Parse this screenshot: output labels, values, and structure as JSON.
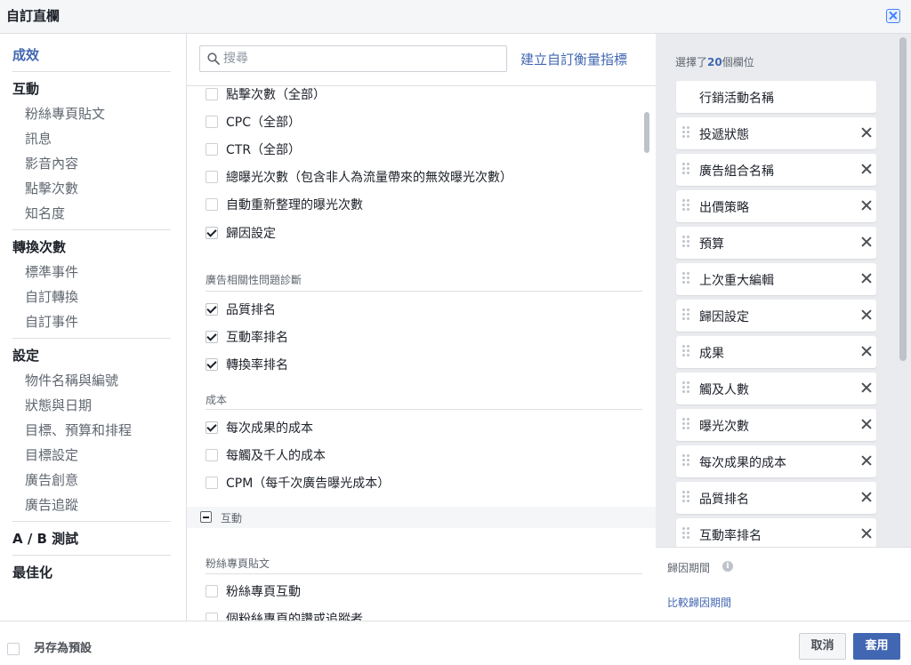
{
  "dialog": {
    "title": "自訂直欄"
  },
  "nav": {
    "items": [
      {
        "label": "成效",
        "type": "category",
        "active": true
      },
      {
        "label": "互動",
        "type": "category"
      },
      {
        "label": "粉絲專頁貼文",
        "type": "sub"
      },
      {
        "label": "訊息",
        "type": "sub"
      },
      {
        "label": "影音內容",
        "type": "sub"
      },
      {
        "label": "點擊次數",
        "type": "sub"
      },
      {
        "label": "知名度",
        "type": "sub"
      },
      {
        "label": "轉換次數",
        "type": "category"
      },
      {
        "label": "標準事件",
        "type": "sub"
      },
      {
        "label": "自訂轉換",
        "type": "sub"
      },
      {
        "label": "自訂事件",
        "type": "sub"
      },
      {
        "label": "設定",
        "type": "category"
      },
      {
        "label": "物件名稱與編號",
        "type": "sub"
      },
      {
        "label": "狀態與日期",
        "type": "sub"
      },
      {
        "label": "目標、預算和排程",
        "type": "sub"
      },
      {
        "label": "目標設定",
        "type": "sub"
      },
      {
        "label": "廣告創意",
        "type": "sub"
      },
      {
        "label": "廣告追蹤",
        "type": "sub"
      },
      {
        "label": "A / B 測試",
        "type": "category"
      },
      {
        "label": "最佳化",
        "type": "category"
      }
    ]
  },
  "search": {
    "placeholder": "搜尋",
    "value": ""
  },
  "create_metric_link": "建立自訂衡量指標",
  "options": [
    {
      "label": "點擊次數（全部）",
      "checked": false
    },
    {
      "label": "CPC（全部）",
      "checked": false
    },
    {
      "label": "CTR（全部）",
      "checked": false
    },
    {
      "label": "總曝光次數（包含非人為流量帶來的無效曝光次數）",
      "checked": false
    },
    {
      "label": "自動重新整理的曝光次數",
      "checked": false
    },
    {
      "label": "歸因設定",
      "checked": true
    },
    {
      "label": "品質排名",
      "checked": true
    },
    {
      "label": "互動率排名",
      "checked": true
    },
    {
      "label": "轉換率排名",
      "checked": true
    },
    {
      "label": "每次成果的成本",
      "checked": true
    },
    {
      "label": "每觸及千人的成本",
      "checked": false
    },
    {
      "label": "CPM（每千次廣告曝光成本）",
      "checked": false
    },
    {
      "label": "粉絲專頁互動",
      "checked": false
    },
    {
      "label": "個粉絲專頁的讚或追蹤者",
      "checked": false
    }
  ],
  "sections": {
    "relevance": "廣告相關性問題診斷",
    "cost": "成本",
    "engagement_group": "互動",
    "page_posts": "粉絲專頁貼文"
  },
  "selected": {
    "prefix": "選擇了",
    "count": "20",
    "suffix": "個欄位",
    "columns": [
      {
        "label": "行銷活動名稱",
        "fixed": true
      },
      {
        "label": "投遞狀態"
      },
      {
        "label": "廣告組合名稱"
      },
      {
        "label": "出價策略"
      },
      {
        "label": "預算"
      },
      {
        "label": "上次重大編輯"
      },
      {
        "label": "歸因設定"
      },
      {
        "label": "成果"
      },
      {
        "label": "觸及人數"
      },
      {
        "label": "曝光次數"
      },
      {
        "label": "每次成果的成本"
      },
      {
        "label": "品質排名"
      },
      {
        "label": "互動率排名"
      }
    ]
  },
  "attribution": {
    "title": "歸因期間",
    "info_icon": "info-icon",
    "compare_link": "比較歸因期間"
  },
  "footer": {
    "save_preset_label": "另存為預設",
    "cancel_label": "取消",
    "apply_label": "套用"
  },
  "colors": {
    "accent": "#4267b2",
    "panel_bg": "#e9ebee",
    "border": "#dddfe2"
  }
}
